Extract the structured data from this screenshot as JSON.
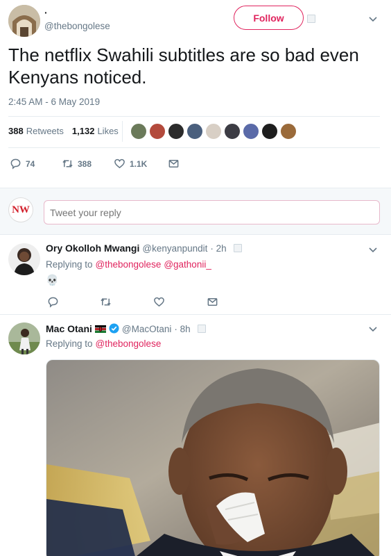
{
  "main_tweet": {
    "display_name": "·",
    "handle": "@thebongolese",
    "follow_label": "Follow",
    "text": "The netflix Swahili subtitles are so bad even Kenyans noticed.",
    "timestamp": "2:45 AM - 6 May 2019",
    "retweets_count": "388",
    "retweets_label": "Retweets",
    "likes_count": "1,132",
    "likes_label": "Likes",
    "actions": {
      "replies": "74",
      "retweets": "388",
      "likes": "1.1K"
    }
  },
  "reply_box": {
    "logo_text": "NW",
    "placeholder": "Tweet your reply"
  },
  "replies": [
    {
      "display_name": "Ory Okolloh Mwangi",
      "handle": "@kenyanpundit",
      "time": "· 2h",
      "replying_to_label": "Replying to",
      "mentions": [
        "@thebongolese",
        "@gathonii_"
      ],
      "text": "💀"
    },
    {
      "display_name": "Mac Otani",
      "flag": "🇰🇪",
      "handle": "@MacOtani",
      "time": "· 8h",
      "replying_to_label": "Replying to",
      "mentions": [
        "@thebongolese"
      ]
    }
  ],
  "colors": {
    "accent": "#e0245e",
    "muted": "#657786",
    "text": "#14171a",
    "verified": "#1da1f2"
  }
}
